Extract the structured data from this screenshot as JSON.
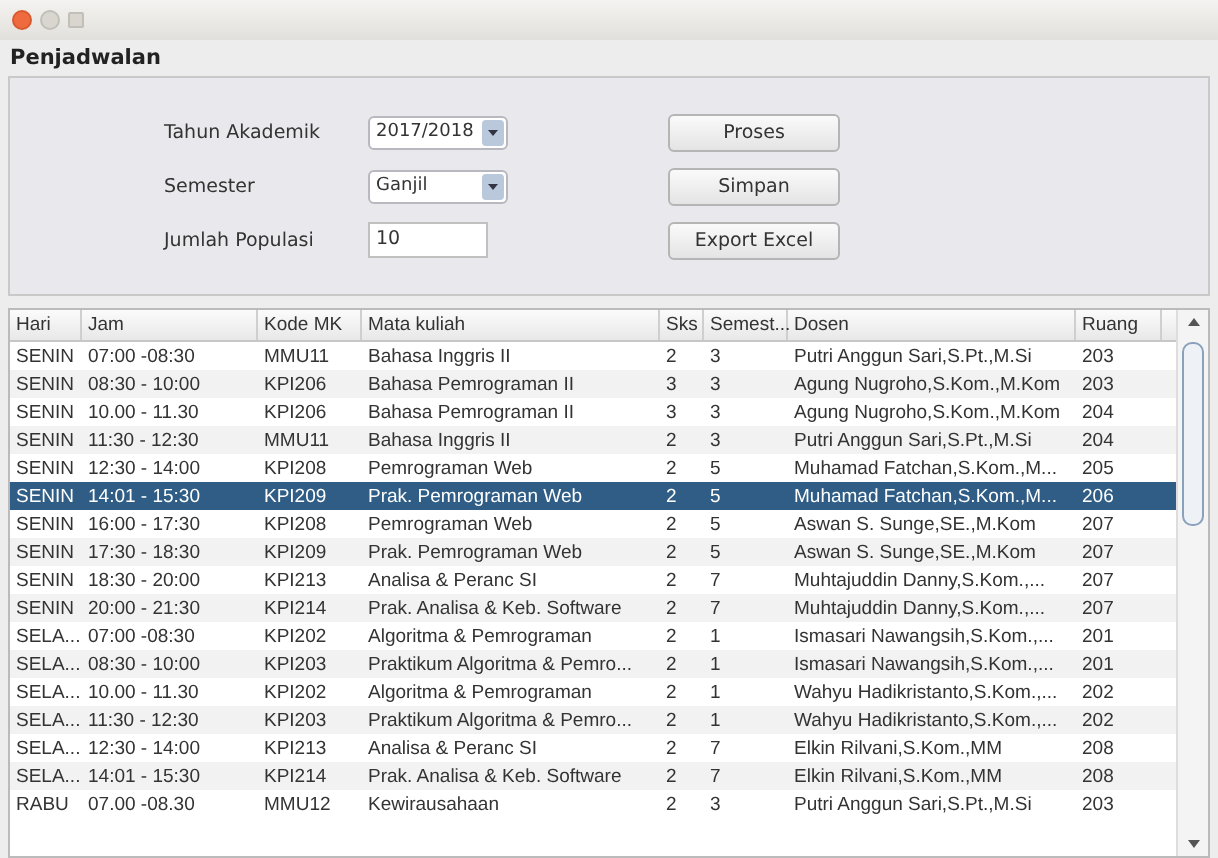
{
  "window": {
    "title": "Penjadwalan"
  },
  "form": {
    "fields": [
      {
        "label": "Tahun Akademik",
        "kind": "dropdown",
        "value": "2017/2018"
      },
      {
        "label": "Semester",
        "kind": "dropdown",
        "value": "Ganjil"
      },
      {
        "label": "Jumlah Populasi",
        "kind": "text",
        "value": "10"
      }
    ],
    "buttons": [
      "Proses",
      "Simpan",
      "Export Excel"
    ]
  },
  "table": {
    "columns": [
      "Hari",
      "Jam",
      "Kode MK",
      "Mata kuliah",
      "Sks",
      "Semest...",
      "Dosen",
      "Ruang"
    ],
    "rows": [
      {
        "cells": [
          "SENIN",
          "07:00 -08:30",
          "MMU11",
          "Bahasa Inggris II",
          "2",
          "3",
          "Putri Anggun Sari,S.Pt.,M.Si",
          "203"
        ],
        "selected": false
      },
      {
        "cells": [
          "SENIN",
          "08:30 - 10:00",
          "KPI206",
          "Bahasa Pemrograman II",
          "3",
          "3",
          "Agung Nugroho,S.Kom.,M.Kom",
          "203"
        ],
        "selected": false
      },
      {
        "cells": [
          "SENIN",
          "10.00 - 11.30",
          "KPI206",
          "Bahasa Pemrograman II",
          "3",
          "3",
          "Agung Nugroho,S.Kom.,M.Kom",
          "204"
        ],
        "selected": false
      },
      {
        "cells": [
          "SENIN",
          "11:30 - 12:30",
          "MMU11",
          "Bahasa Inggris II",
          "2",
          "3",
          "Putri Anggun Sari,S.Pt.,M.Si",
          "204"
        ],
        "selected": false
      },
      {
        "cells": [
          "SENIN",
          "12:30 - 14:00",
          "KPI208",
          "Pemrograman Web",
          "2",
          "5",
          "Muhamad Fatchan,S.Kom.,M...",
          "205"
        ],
        "selected": false
      },
      {
        "cells": [
          "SENIN",
          "14:01 - 15:30",
          "KPI209",
          "Prak. Pemrograman Web",
          "2",
          "5",
          "Muhamad Fatchan,S.Kom.,M...",
          "206"
        ],
        "selected": true
      },
      {
        "cells": [
          "SENIN",
          "16:00 - 17:30",
          "KPI208",
          "Pemrograman Web",
          "2",
          "5",
          "Aswan S. Sunge,SE.,M.Kom",
          "207"
        ],
        "selected": false
      },
      {
        "cells": [
          "SENIN",
          "17:30 - 18:30",
          "KPI209",
          "Prak. Pemrograman Web",
          "2",
          "5",
          "Aswan S. Sunge,SE.,M.Kom",
          "207"
        ],
        "selected": false
      },
      {
        "cells": [
          "SENIN",
          "18:30 - 20:00",
          "KPI213",
          "Analisa & Peranc SI",
          "2",
          "7",
          "Muhtajuddin Danny,S.Kom.,...",
          "207"
        ],
        "selected": false
      },
      {
        "cells": [
          "SENIN",
          "20:00 - 21:30",
          "KPI214",
          "Prak. Analisa & Keb. Software",
          "2",
          "7",
          "Muhtajuddin Danny,S.Kom.,...",
          "207"
        ],
        "selected": false
      },
      {
        "cells": [
          "SELA...",
          "07:00 -08:30",
          "KPI202",
          "Algoritma & Pemrograman",
          "2",
          "1",
          "Ismasari Nawangsih,S.Kom.,...",
          "201"
        ],
        "selected": false
      },
      {
        "cells": [
          "SELA...",
          "08:30 - 10:00",
          "KPI203",
          "Praktikum Algoritma & Pemro...",
          "2",
          "1",
          "Ismasari Nawangsih,S.Kom.,...",
          "201"
        ],
        "selected": false
      },
      {
        "cells": [
          "SELA...",
          "10.00 - 11.30",
          "KPI202",
          "Algoritma & Pemrograman",
          "2",
          "1",
          "Wahyu Hadikristanto,S.Kom.,...",
          "202"
        ],
        "selected": false
      },
      {
        "cells": [
          "SELA...",
          "11:30 - 12:30",
          "KPI203",
          "Praktikum Algoritma & Pemro...",
          "2",
          "1",
          "Wahyu Hadikristanto,S.Kom.,...",
          "202"
        ],
        "selected": false
      },
      {
        "cells": [
          "SELA...",
          "12:30 - 14:00",
          "KPI213",
          "Analisa & Peranc SI",
          "2",
          "7",
          "Elkin Rilvani,S.Kom.,MM",
          "208"
        ],
        "selected": false
      },
      {
        "cells": [
          "SELA...",
          "14:01 - 15:30",
          "KPI214",
          "Prak. Analisa & Keb. Software",
          "2",
          "7",
          "Elkin Rilvani,S.Kom.,MM",
          "208"
        ],
        "selected": false
      },
      {
        "cells": [
          "RABU",
          "07.00 -08.30",
          "MMU12",
          "Kewirausahaan",
          "2",
          "3",
          "Putri Anggun Sari,S.Pt.,M.Si",
          "203"
        ],
        "selected": false
      }
    ]
  }
}
